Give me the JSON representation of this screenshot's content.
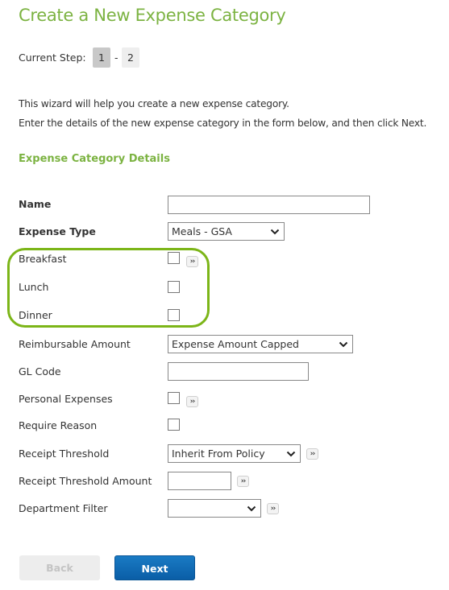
{
  "page": {
    "title": "Create a New Expense Category"
  },
  "steps": {
    "label": "Current Step:",
    "items": [
      "1",
      "2"
    ],
    "separator": "-",
    "current": "1"
  },
  "intro": {
    "line1": "This wizard will help you create a new expense category.",
    "line2": "Enter the details of the new expense category in the form below, and then click Next."
  },
  "section": {
    "title": "Expense Category Details"
  },
  "form": {
    "name": {
      "label": "Name",
      "value": ""
    },
    "expense_type": {
      "label": "Expense Type",
      "selected": "Meals - GSA"
    },
    "breakfast": {
      "label": "Breakfast",
      "checked": false,
      "expand_icon": "double-chevron-right-icon"
    },
    "lunch": {
      "label": "Lunch",
      "checked": false
    },
    "dinner": {
      "label": "Dinner",
      "checked": false
    },
    "reimbursable_amount": {
      "label": "Reimbursable Amount",
      "selected": "Expense Amount Capped"
    },
    "gl_code": {
      "label": "GL Code",
      "value": ""
    },
    "personal_expenses": {
      "label": "Personal Expenses",
      "checked": false,
      "expand_icon": "double-chevron-right-icon"
    },
    "require_reason": {
      "label": "Require Reason",
      "checked": false
    },
    "receipt_threshold": {
      "label": "Receipt Threshold",
      "selected": "Inherit From Policy",
      "expand_icon": "double-chevron-right-icon"
    },
    "receipt_threshold_amount": {
      "label": "Receipt Threshold Amount",
      "value": "",
      "expand_icon": "double-chevron-right-icon"
    },
    "department_filter": {
      "label": "Department Filter",
      "selected": "",
      "expand_icon": "double-chevron-right-icon"
    }
  },
  "expand_glyph": "››",
  "buttons": {
    "back": {
      "label": "Back",
      "enabled": false
    },
    "next": {
      "label": "Next",
      "enabled": true
    }
  },
  "colors": {
    "accent_green": "#7cb342",
    "highlight_green": "#7cb518",
    "primary_blue": "#0a6ab5"
  }
}
